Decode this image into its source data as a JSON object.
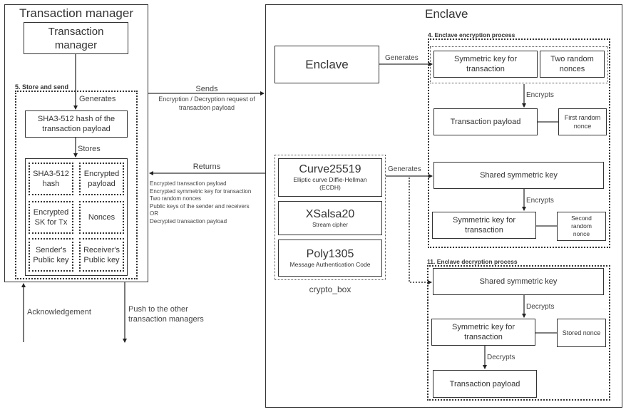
{
  "transaction_manager": {
    "outer_title": "Transaction manager",
    "inner_box": "Transaction manager",
    "store_and_send_label": "5. Store and send",
    "generates_label": "Generates",
    "hash_box": "SHA3-512 hash of the transaction payload",
    "stores_label": "Stores",
    "stored_items": [
      "SHA3-512 hash",
      "Encrypted payload",
      "Encrypted SK for Tx",
      "Nonces",
      "Sender's Public key",
      "Receiver's Public key"
    ],
    "acknowledgement_label": "Acknowledgement",
    "push_label_line1": "Push to the other",
    "push_label_line2": "transaction managers"
  },
  "messages": {
    "sends_label": "Sends",
    "sends_detail_line1": "Encryption / Decryption request of",
    "sends_detail_line2": "transaction payload",
    "returns_label": "Returns",
    "returns_items": [
      "Encrypted transaction payload",
      "Encrypted symmetric key for transaction",
      "Two random nonces",
      "Public keys of the sender and receivers",
      "OR",
      "Decrypted transaction payload"
    ]
  },
  "enclave": {
    "outer_title": "Enclave",
    "inner_box": "Enclave",
    "generates_label": "Generates",
    "generates_label_2": "Generates",
    "crypto_box": {
      "label": "crypto_box",
      "items": [
        {
          "name": "Curve25519",
          "desc_line1": "Elliptic curve Diffie-Hellman",
          "desc_line2": "(ECDH)"
        },
        {
          "name": "XSalsa20",
          "desc_line1": "Stream cipher",
          "desc_line2": ""
        },
        {
          "name": "Poly1305",
          "desc_line1": "Message Authentication Code",
          "desc_line2": ""
        }
      ]
    },
    "encryption_process": {
      "title": "4. Enclave encryption process",
      "sym_key": "Symmetric key for transaction",
      "two_nonces": "Two random nonces",
      "encrypts_1": "Encrypts",
      "tx_payload": "Transaction payload",
      "first_nonce": "First random nonce",
      "shared_key": "Shared symmetric key",
      "encrypts_2": "Encrypts",
      "sym_key_2": "Symmetric key for transaction",
      "second_nonce_line1": "Second",
      "second_nonce_line2": "random",
      "second_nonce_line3": "nonce"
    },
    "decryption_process": {
      "title": "11. Enclave decryption process",
      "shared_key": "Shared symmetric key",
      "decrypts_1": "Decrypts",
      "sym_key": "Symmetric key for transaction",
      "stored_nonce": "Stored nonce",
      "decrypts_2": "Decrypts",
      "tx_payload": "Transaction payload"
    }
  }
}
